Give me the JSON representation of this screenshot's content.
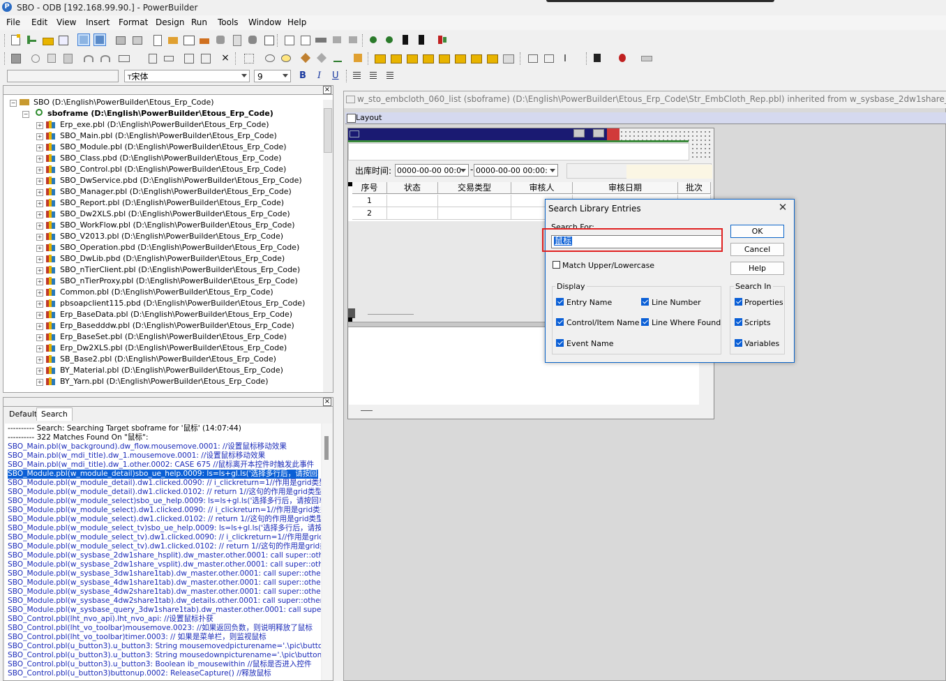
{
  "window": {
    "title": "SBO - ODB [192.168.99.90.]  - PowerBuilder",
    "app_icon": "P"
  },
  "menu": [
    "File",
    "Edit",
    "View",
    "Insert",
    "Format",
    "Design",
    "Run",
    "Tools",
    "Window",
    "Help"
  ],
  "format_bar": {
    "font_name": "宋体",
    "font_name_prefix": "T",
    "font_size": "9",
    "bold": "B",
    "italic": "I",
    "underline": "U"
  },
  "tree": {
    "root": "SBO (D:\\English\\PowerBuilder\\Etous_Erp_Code)",
    "target": "sboframe (D:\\English\\PowerBuilder\\Etous_Erp_Code)",
    "items": [
      "Erp_exe.pbl (D:\\English\\PowerBuilder\\Etous_Erp_Code)",
      "SBO_Main.pbl (D:\\English\\PowerBuilder\\Etous_Erp_Code)",
      "SBO_Module.pbl (D:\\English\\PowerBuilder\\Etous_Erp_Code)",
      "SBO_Class.pbd (D:\\English\\PowerBuilder\\Etous_Erp_Code)",
      "SBO_Control.pbl (D:\\English\\PowerBuilder\\Etous_Erp_Code)",
      "SBO_DwService.pbd (D:\\English\\PowerBuilder\\Etous_Erp_Code)",
      "SBO_Manager.pbl (D:\\English\\PowerBuilder\\Etous_Erp_Code)",
      "SBO_Report.pbl (D:\\English\\PowerBuilder\\Etous_Erp_Code)",
      "SBO_Dw2XLS.pbl (D:\\English\\PowerBuilder\\Etous_Erp_Code)",
      "SBO_WorkFlow.pbl (D:\\English\\PowerBuilder\\Etous_Erp_Code)",
      "SBO_V2013.pbl (D:\\English\\PowerBuilder\\Etous_Erp_Code)",
      "SBO_Operation.pbd (D:\\English\\PowerBuilder\\Etous_Erp_Code)",
      "SBO_DwLib.pbd (D:\\English\\PowerBuilder\\Etous_Erp_Code)",
      "SBO_nTierClient.pbl (D:\\English\\PowerBuilder\\Etous_Erp_Code)",
      "SBO_nTierProxy.pbl (D:\\English\\PowerBuilder\\Etous_Erp_Code)",
      "Common.pbl (D:\\English\\PowerBuilder\\Etous_Erp_Code)",
      "pbsoapclient115.pbd (D:\\English\\PowerBuilder\\Etous_Erp_Code)",
      "Erp_BaseData.pbl (D:\\English\\PowerBuilder\\Etous_Erp_Code)",
      "Erp_Basedddw.pbl (D:\\English\\PowerBuilder\\Etous_Erp_Code)",
      "Erp_BaseSet.pbl (D:\\English\\PowerBuilder\\Etous_Erp_Code)",
      "Erp_Dw2XLS.pbl (D:\\English\\PowerBuilder\\Etous_Erp_Code)",
      "SB_Base2.pbl (D:\\English\\PowerBuilder\\Etous_Erp_Code)",
      "BY_Material.pbl (D:\\English\\PowerBuilder\\Etous_Erp_Code)",
      "BY_Yarn.pbl (D:\\English\\PowerBuilder\\Etous_Erp_Code)"
    ]
  },
  "output": {
    "tabs": [
      "Default",
      "Search"
    ],
    "lines": [
      "---------- Search: Searching Target sboframe for '鼠标'    (14:07:44)",
      "---------- 322 Matches Found On \"鼠标\":",
      "SBO_Main.pbl(w_background).dw_flow.mousemove.0001:  //设置鼠标移动效果",
      "SBO_Main.pbl(w_mdi_title).dw_1.mousemove.0001:  //设置鼠标移动效果",
      "SBO_Main.pbl(w_mdi_title).dw_1.other.0002:  CASE 675   //鼠标离开本控件时触发此事件",
      "SBO_Module.pbl(w_module_detail)sbo_ue_help.0009:   ls=ls+gl.ls('选择多行后，请按回车",
      "SBO_Module.pbl(w_module_detail).dw1.clicked.0090:  // i_clickreturn=1//作用是grid类型dw",
      "SBO_Module.pbl(w_module_detail).dw1.clicked.0102:  // return 1//这句的作用是grid类型d",
      "SBO_Module.pbl(w_module_select)sbo_ue_help.0009:   ls=ls+gl.ls('选择多行后，请按回车",
      "SBO_Module.pbl(w_module_select).dw1.clicked.0090:  // i_clickreturn=1//作用是grid类型dw",
      "SBO_Module.pbl(w_module_select).dw1.clicked.0102:  // return 1//这句的作用是grid类型d",
      "SBO_Module.pbl(w_module_select_tv)sbo_ue_help.0009:   ls=ls+gl.ls('选择多行后，请按回",
      "SBO_Module.pbl(w_module_select_tv).dw1.clicked.0090:  // i_clickreturn=1//作用是grid类",
      "SBO_Module.pbl(w_module_select_tv).dw1.clicked.0102:  // return 1//这句的作用是grid类",
      "SBO_Module.pbl(w_sysbase_2dw1share_hsplit).dw_master.other.0001:  call super::other;//",
      "SBO_Module.pbl(w_sysbase_2dw1share_vsplit).dw_master.other.0001:  call super::other;//",
      "SBO_Module.pbl(w_sysbase_3dw1share1tab).dw_master.other.0001:  call super::other;//鼠",
      "SBO_Module.pbl(w_sysbase_4dw1share1tab).dw_master.other.0001:  call super::other;//鼠",
      "SBO_Module.pbl(w_sysbase_4dw2share1tab).dw_master.other.0001:  call super::other;//鼠",
      "SBO_Module.pbl(w_sysbase_4dw2share1tab).dw_details.other.0001:  call super::other;//鼠",
      "SBO_Module.pbl(w_sysbase_query_3dw1share1tab).dw_master.other.0001:  call super::oth",
      "SBO_Control.pbl(lht_nvo_api).lht_nvo_api:  //设置鼠标扑获",
      "SBO_Control.pbl(lht_vo_toolbar)mousemove.0023:   //如果返回负数，则说明释放了鼠标",
      "SBO_Control.pbl(lht_vo_toolbar)timer.0003:  // 如果是菜单栏，则监视鼠标",
      "SBO_Control.pbl(u_button3).u_button3:  String    mousemovedpicturename='.\\pic\\button2.",
      "SBO_Control.pbl(u_button3).u_button3:  String    mousedownpicturename='.\\pic\\button3.b",
      "SBO_Control.pbl(u_button3).u_button3:  Boolean ib_mousewithin   //鼠标是否进入控件",
      "SBO_Control.pbl(u_button3)buttonup.0002:  ReleaseCapture() //释放鼠标"
    ],
    "selected_index": 5
  },
  "editor": {
    "title": "w_sto_embcloth_060_list (sboframe) (D:\\English\\PowerBuilder\\Etous_Erp_Code\\Str_EmbCloth_Rep.pbl) inherited from w_sysbase_2dw1share_hsplit",
    "layout_tab": "Layout",
    "filter_label": "出库时间:",
    "date_from": "0000-00-00 00:0",
    "date_dash": "-",
    "date_to": "0000-00-00 00:00:",
    "grid_headers": [
      "序号",
      "状态",
      "交易类型",
      "审核人",
      "审核日期",
      "批次"
    ],
    "grid_rows": [
      "1",
      "2"
    ]
  },
  "dialog": {
    "title": "Search Library Entries",
    "search_for_label": "Search For:",
    "search_value": "鼠标",
    "ok": "OK",
    "cancel": "Cancel",
    "help": "Help",
    "match_case": "Match Upper/Lowercase",
    "display_label": "Display",
    "display_options": [
      {
        "label": "Entry Name",
        "checked": true
      },
      {
        "label": "Line Number",
        "checked": true
      },
      {
        "label": "Control/Item Name",
        "checked": true
      },
      {
        "label": "Line Where Found",
        "checked": true
      },
      {
        "label": "Event Name",
        "checked": true
      }
    ],
    "search_in_label": "Search In",
    "search_in_options": [
      {
        "label": "Properties",
        "checked": true
      },
      {
        "label": "Scripts",
        "checked": true
      },
      {
        "label": "Variables",
        "checked": true
      }
    ]
  },
  "colors": {
    "accent": "#0a5fd6",
    "highlight_box": "#e02020",
    "output_text": "#1a2ab8"
  }
}
